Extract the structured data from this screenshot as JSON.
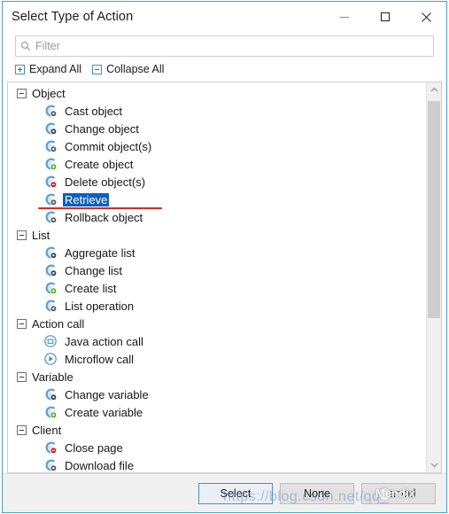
{
  "window": {
    "title": "Select Type of Action",
    "caption_buttons": [
      {
        "name": "minimize",
        "glyph": "minimize-icon"
      },
      {
        "name": "maximize",
        "glyph": "maximize-icon"
      },
      {
        "name": "close",
        "glyph": "close-icon"
      }
    ]
  },
  "filter": {
    "placeholder": "Filter",
    "value": "",
    "icon": "search-icon"
  },
  "toolbar": {
    "expand_all_label": "Expand All",
    "collapse_all_label": "Collapse All",
    "expand_icon": "plus-box-icon",
    "collapse_icon": "minus-box-icon"
  },
  "tree": {
    "groups": [
      {
        "label": "Object",
        "expanded": true,
        "items": [
          {
            "label": "Cast object",
            "icon": "object-cast-icon",
            "badge": "#5a5a5a",
            "selected": false
          },
          {
            "label": "Change object",
            "icon": "object-change-icon",
            "badge": "#3f3f3f",
            "selected": false
          },
          {
            "label": "Commit object(s)",
            "icon": "object-commit-icon",
            "badge": "#5a5a5a",
            "selected": false
          },
          {
            "label": "Create object",
            "icon": "object-create-icon",
            "badge": "#4caf17",
            "selected": false
          },
          {
            "label": "Delete object(s)",
            "icon": "object-delete-icon",
            "badge": "#e0161a",
            "selected": false
          },
          {
            "label": "Retrieve",
            "icon": "object-retrieve-icon",
            "badge": "#5a5a5a",
            "selected": true
          },
          {
            "label": "Rollback object",
            "icon": "object-rollback-icon",
            "badge": "#5a5a5a",
            "selected": false
          }
        ]
      },
      {
        "label": "List",
        "expanded": true,
        "items": [
          {
            "label": "Aggregate list",
            "icon": "list-aggregate-icon",
            "badge": "#3f3f3f",
            "selected": false
          },
          {
            "label": "Change list",
            "icon": "list-change-icon",
            "badge": "#3f3f3f",
            "selected": false
          },
          {
            "label": "Create list",
            "icon": "list-create-icon",
            "badge": "#4caf17",
            "selected": false
          },
          {
            "label": "List operation",
            "icon": "list-operation-icon",
            "badge": "#5a5a5a",
            "selected": false
          }
        ]
      },
      {
        "label": "Action call",
        "expanded": true,
        "items": [
          {
            "label": "Java action call",
            "icon": "java-action-icon",
            "badge": "",
            "selected": false
          },
          {
            "label": "Microflow call",
            "icon": "microflow-icon",
            "badge": "",
            "selected": false
          }
        ]
      },
      {
        "label": "Variable",
        "expanded": true,
        "items": [
          {
            "label": "Change variable",
            "icon": "variable-change-icon",
            "badge": "#3f3f3f",
            "selected": false
          },
          {
            "label": "Create variable",
            "icon": "variable-create-icon",
            "badge": "#4caf17",
            "selected": false
          }
        ]
      },
      {
        "label": "Client",
        "expanded": true,
        "items": [
          {
            "label": "Close page",
            "icon": "client-close-icon",
            "badge": "#e0161a",
            "selected": false
          },
          {
            "label": "Download file",
            "icon": "client-download-icon",
            "badge": "#5a5a5a",
            "selected": false
          }
        ]
      }
    ]
  },
  "scrollbar": {
    "up_icon": "chevron-up-icon",
    "down_icon": "chevron-down-icon"
  },
  "footer": {
    "select_label": "Select",
    "none_label": "None",
    "cancel_label": "Cancel"
  },
  "annotation": {
    "underline_color": "#e8241c"
  },
  "watermark": {
    "url_text": "https://blog.csdn.net/qq_",
    "logo_text": "Mendix"
  }
}
